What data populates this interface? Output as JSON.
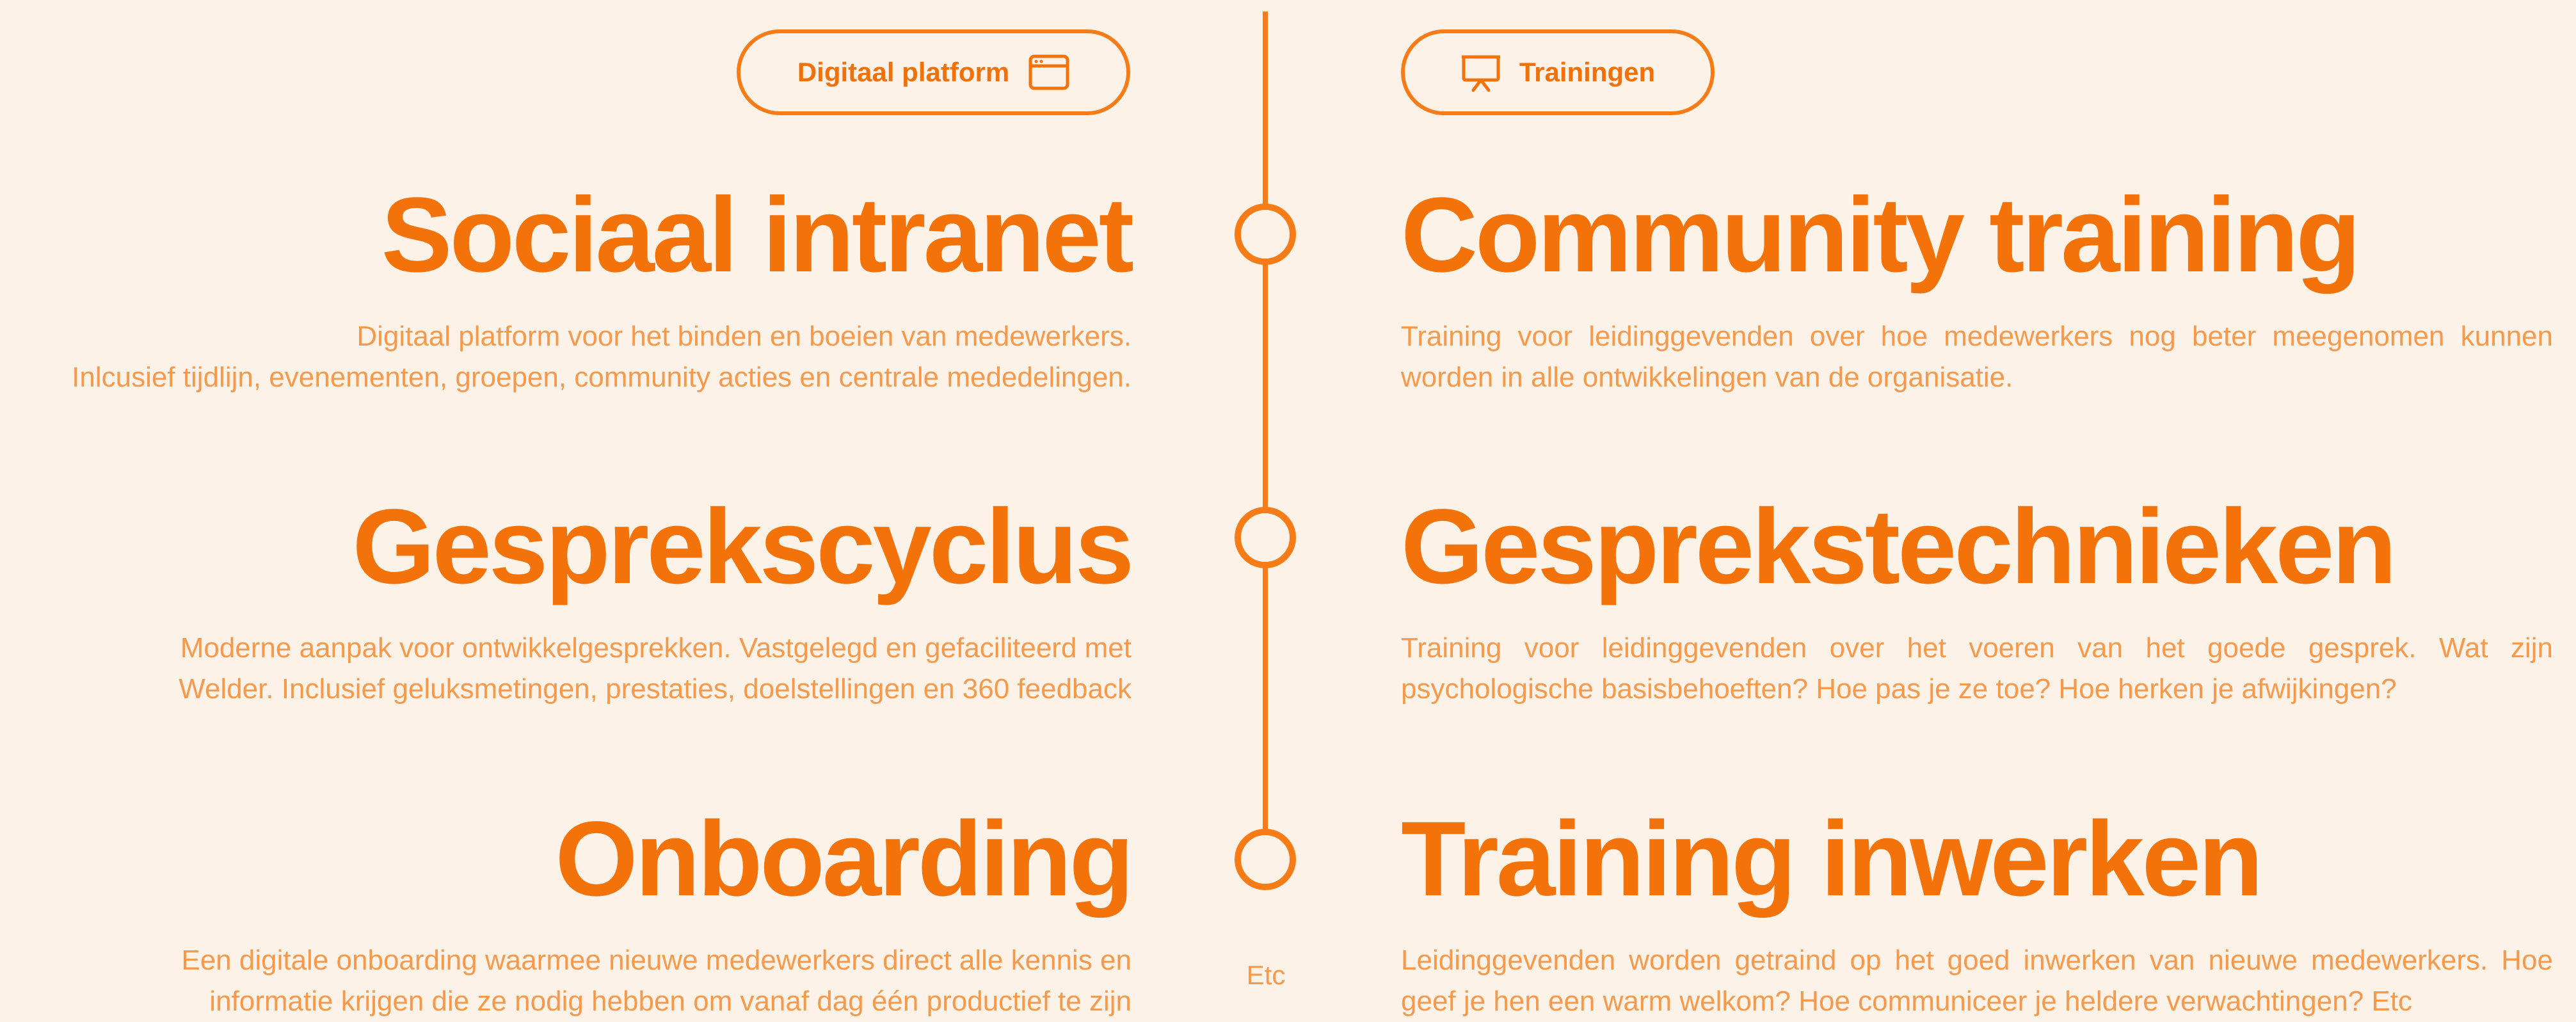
{
  "colors": {
    "accent": "#f37209",
    "text_light": "#f59a4c",
    "background": "#fdf2e7"
  },
  "left_pill": {
    "label": "Digitaal platform",
    "icon": "browser-window-icon"
  },
  "right_pill": {
    "label": "Trainingen",
    "icon": "presentation-board-icon"
  },
  "left_items": [
    {
      "title": "Sociaal intranet",
      "lines": [
        "Digitaal platform voor het binden en boeien van medewerkers.",
        "Inlcusief tijdlijn, evenementen, groepen, community acties en centrale mededelingen."
      ]
    },
    {
      "title": "Gesprekscyclus",
      "lines": [
        "Moderne aanpak voor ontwikkelgesprekken. Vastgelegd en gefaciliteerd met",
        "Welder. Inclusief geluksmetingen, prestaties, doelstellingen en 360 feedback"
      ]
    },
    {
      "title": "Onboarding",
      "lines": [
        "Een digitale onboarding waarmee nieuwe medewerkers direct alle kennis en",
        "informatie krijgen die ze nodig hebben om vanaf dag één productief te zijn"
      ]
    }
  ],
  "right_items": [
    {
      "title": "Community training",
      "text": "Training voor leidinggevenden over hoe medewerkers nog beter meegenomen kunnen worden in alle ontwikkelingen van de organisatie."
    },
    {
      "title": "Gesprekstechnieken",
      "text": "Training voor leidinggevenden over het voeren van het goede gesprek. Wat zijn psychologische basisbehoeften? Hoe pas je ze toe? Hoe herken je afwijkingen?"
    },
    {
      "title": "Training inwerken",
      "text": "Leidinggevenden worden getraind op het goed inwerken van nieuwe medewerkers. Hoe geef je hen een warm welkom? Hoe communiceer je heldere verwachtingen? Etc"
    }
  ],
  "timeline": {
    "footer": "Etc"
  }
}
